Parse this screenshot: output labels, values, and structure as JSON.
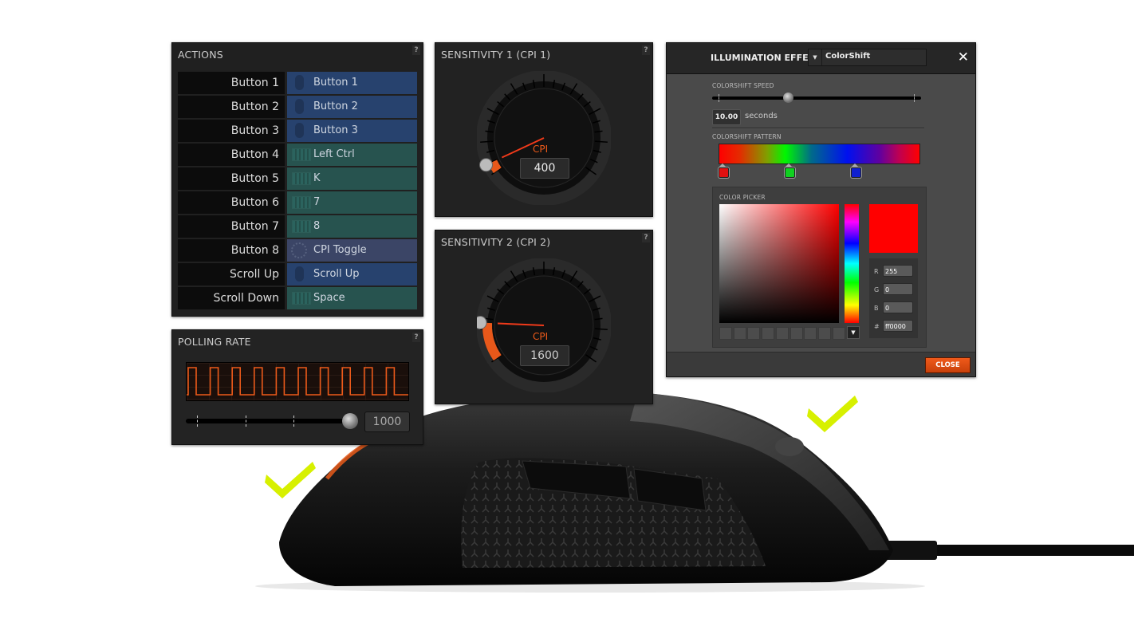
{
  "actions": {
    "title": "ACTIONS",
    "help": "?",
    "rows": [
      {
        "button": "Button 1",
        "action": "Button 1",
        "type": "mouse",
        "icon": "mouse-icon"
      },
      {
        "button": "Button 2",
        "action": "Button 2",
        "type": "mouse",
        "icon": "mouse-icon"
      },
      {
        "button": "Button 3",
        "action": "Button 3",
        "type": "mouse",
        "icon": "mouse-icon"
      },
      {
        "button": "Button 4",
        "action": "Left Ctrl",
        "type": "key",
        "icon": "keyboard-icon"
      },
      {
        "button": "Button 5",
        "action": "K",
        "type": "key",
        "icon": "keyboard-icon"
      },
      {
        "button": "Button 6",
        "action": "7",
        "type": "key",
        "icon": "keyboard-icon"
      },
      {
        "button": "Button 7",
        "action": "8",
        "type": "key",
        "icon": "keyboard-icon"
      },
      {
        "button": "Button 8",
        "action": "CPI Toggle",
        "type": "cpi",
        "icon": "dial-icon"
      },
      {
        "button": "Scroll Up",
        "action": "Scroll Up",
        "type": "mouse",
        "icon": "mouse-icon"
      },
      {
        "button": "Scroll Down",
        "action": "Space",
        "type": "key",
        "icon": "keyboard-icon"
      }
    ]
  },
  "polling": {
    "title": "POLLING RATE",
    "help": "?",
    "value": "1000",
    "slider_fraction": 1.0
  },
  "sensitivity1": {
    "title": "SENSITIVITY 1 (CPI 1)",
    "help": "?",
    "unit": "CPI",
    "value": "400",
    "fraction": 0.04
  },
  "sensitivity2": {
    "title": "SENSITIVITY 2 (CPI 2)",
    "help": "?",
    "unit": "CPI",
    "value": "1600",
    "fraction": 0.15
  },
  "illumination": {
    "title": "ILLUMINATION EFFECT",
    "effect": "ColorShift",
    "speed_label": "COLORSHIFT SPEED",
    "speed_value": "10.00",
    "speed_unit": "seconds",
    "speed_fraction": 0.34,
    "pattern_label": "COLORSHIFT PATTERN",
    "stops": [
      {
        "color": "#e01010",
        "position": 0.0
      },
      {
        "color": "#10d020",
        "position": 0.33
      },
      {
        "color": "#1020d0",
        "position": 0.66
      }
    ],
    "picker_label": "COLOR PICKER",
    "preview_color": "#ff0000",
    "r_label": "R",
    "r": "255",
    "g_label": "G",
    "g": "0",
    "b_label": "B",
    "b": "0",
    "hex_label": "#",
    "hex": "ff0000",
    "close_label": "CLOSE",
    "swatch_count": 9
  },
  "colors": {
    "accent_orange": "#ec5a1a",
    "check_green": "#d7f000",
    "mouse_action": "#27426e",
    "key_action": "#27534f"
  }
}
